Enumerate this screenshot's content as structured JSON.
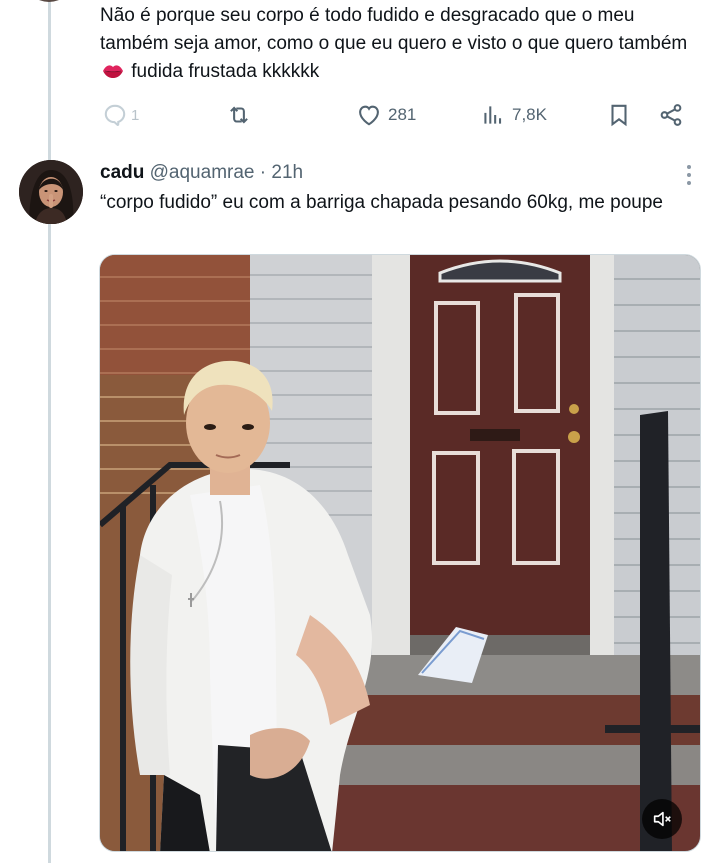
{
  "previous_tweet": {
    "text_before_emoji": "Não é porque seu corpo é todo fudido e desgracado que o meu também seja amor, como o que eu quero e visto o que quero também",
    "text_after_emoji": "fudida frustada kkkkkk",
    "emoji": "kiss-mark-emoji",
    "actions": {
      "reply_count": "1",
      "retweet_count": "",
      "like_count": "281",
      "views_count": "7,8K"
    }
  },
  "tweet": {
    "author_name": "cadu",
    "author_handle": "@aquamrae",
    "separator": "·",
    "time": "21h",
    "text": "“corpo fudido” eu com a barriga chapada pesando 60kg, me poupe",
    "media": {
      "type": "video",
      "mute_icon": "speaker-muted-icon"
    }
  },
  "colors": {
    "text_primary": "#0f1419",
    "text_secondary": "#536471",
    "thread_line": "#cfd9de",
    "lips": "#e0245e"
  }
}
